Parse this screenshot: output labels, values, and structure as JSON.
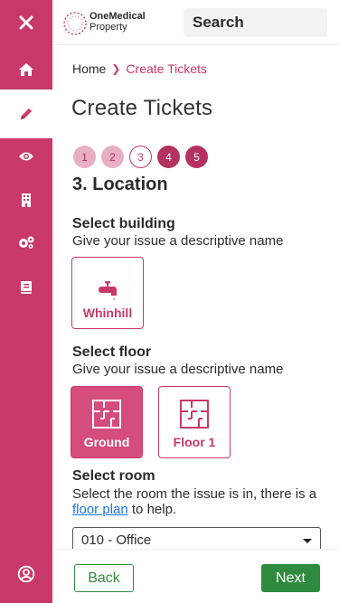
{
  "brand": {
    "line1": "OneMedical",
    "line2": "Property"
  },
  "search": {
    "placeholder": "Search"
  },
  "sidebar": {
    "items": [
      {
        "icon": "close-icon"
      },
      {
        "icon": "home-icon"
      },
      {
        "icon": "pencil-icon",
        "active": true
      },
      {
        "icon": "eye-icon"
      },
      {
        "icon": "building-icon"
      },
      {
        "icon": "gears-icon"
      },
      {
        "icon": "book-icon"
      },
      {
        "icon": "user-circle-icon"
      }
    ]
  },
  "breadcrumb": {
    "home": "Home",
    "current": "Create Tickets"
  },
  "page": {
    "title": "Create Tickets"
  },
  "steps": [
    {
      "label": "1",
      "state": "done"
    },
    {
      "label": "2",
      "state": "done"
    },
    {
      "label": "3",
      "state": "current"
    },
    {
      "label": "4",
      "state": "todo"
    },
    {
      "label": "5",
      "state": "todo"
    }
  ],
  "section": {
    "title": "3. Location"
  },
  "building": {
    "label": "Select building",
    "help": "Give your issue a descriptive name",
    "options": [
      {
        "label": "Whinhill",
        "icon": "tap-icon",
        "selected": false
      }
    ]
  },
  "floor": {
    "label": "Select floor",
    "help": "Give your issue a descriptive name",
    "options": [
      {
        "label": "Ground",
        "icon": "floorplan-icon",
        "selected": true
      },
      {
        "label": "Floor 1",
        "icon": "floorplan-icon",
        "selected": false
      }
    ]
  },
  "room": {
    "label": "Select room",
    "help_before": "Select the room the issue is in, there is a ",
    "help_link": "floor plan",
    "help_after": " to help.",
    "selected": "010 - Office"
  },
  "actions": {
    "back": "Back",
    "next": "Next"
  },
  "colors": {
    "accent": "#c9386a",
    "success": "#2e8b3e",
    "link": "#1a73e8"
  }
}
